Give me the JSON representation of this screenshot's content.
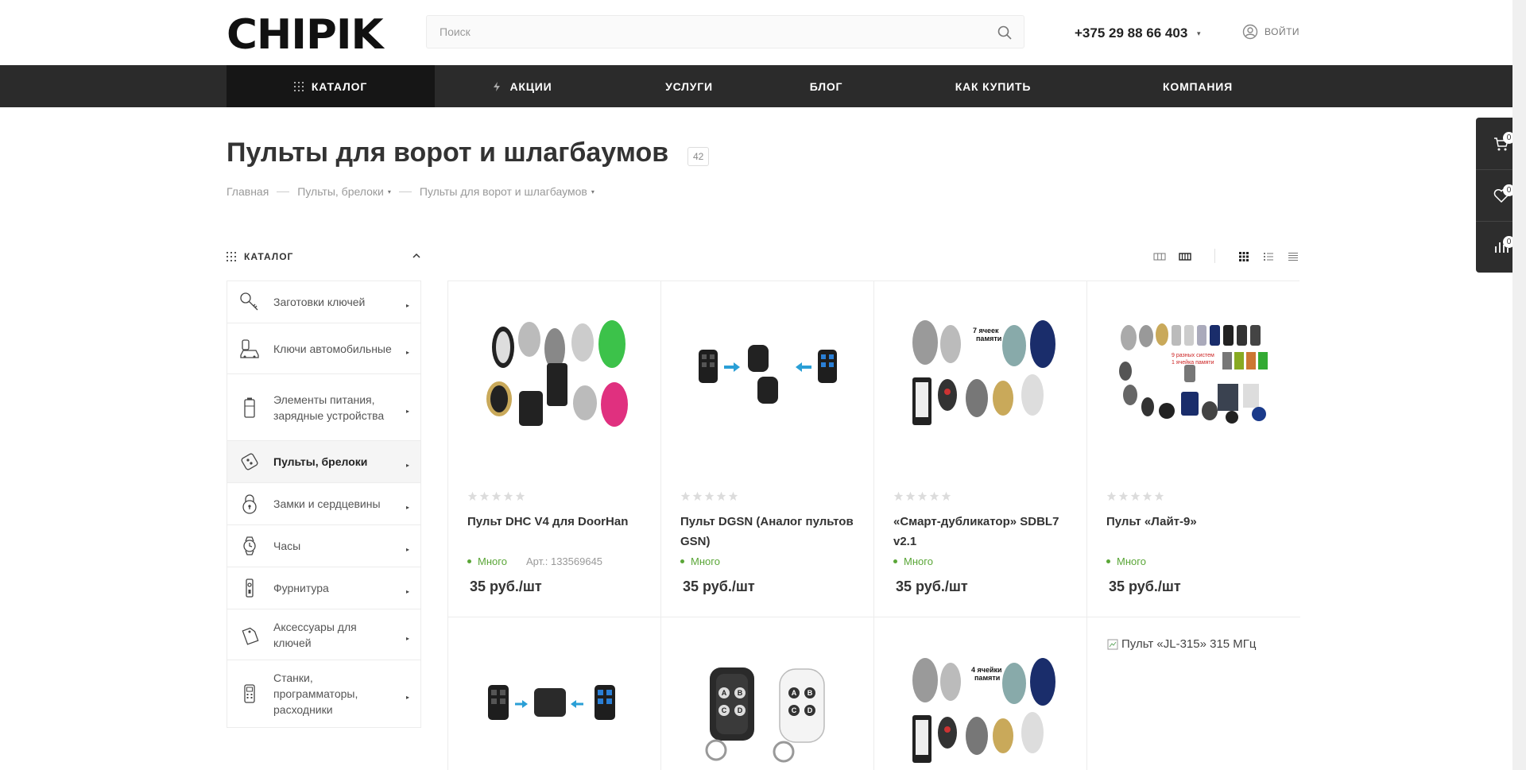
{
  "header": {
    "logo": "CHIPIK",
    "search_placeholder": "Поиск",
    "phone": "+375 29 88 66 403",
    "login_label": "ВОЙТИ"
  },
  "nav": {
    "items": [
      {
        "label": "КАТАЛОГ",
        "icon": "grid-icon"
      },
      {
        "label": "АКЦИИ",
        "icon": "lightning-icon"
      },
      {
        "label": "УСЛУГИ"
      },
      {
        "label": "БЛОГ"
      },
      {
        "label": "КАК КУПИТЬ"
      },
      {
        "label": "КОМПАНИЯ"
      }
    ]
  },
  "page": {
    "title": "Пульты для ворот и шлагбаумов",
    "count": "42",
    "breadcrumbs": [
      "Главная",
      "Пульты, брелоки",
      "Пульты для ворот и шлагбаумов"
    ]
  },
  "sidebar": {
    "heading": "КАТАЛОГ",
    "items": [
      {
        "label": "Заготовки ключей",
        "icon": "key-blank-icon"
      },
      {
        "label": "Ключи автомобильные",
        "icon": "car-key-icon"
      },
      {
        "label": "Элементы питания, зарядные устройства",
        "icon": "battery-icon"
      },
      {
        "label": "Пульты, брелоки",
        "icon": "remote-icon"
      },
      {
        "label": "Замки и сердцевины",
        "icon": "padlock-icon"
      },
      {
        "label": "Часы",
        "icon": "watch-icon"
      },
      {
        "label": "Фурнитура",
        "icon": "door-handle-icon"
      },
      {
        "label": "Аксессуары для ключей",
        "icon": "key-tag-icon"
      },
      {
        "label": "Станки, программаторы, расходники",
        "icon": "programmer-icon"
      }
    ]
  },
  "products": [
    {
      "title": "Пульт DHC V4 для DoorHan",
      "stock": "Много",
      "sku": "Арт.: 133569645",
      "price": "35 руб./шт"
    },
    {
      "title": "Пульт DGSN (Аналог пультов GSN)",
      "stock": "Много",
      "sku": "",
      "price": "35 руб./шт"
    },
    {
      "title": "«Смарт-дубликатор» SDBL7 v2.1",
      "stock": "Много",
      "sku": "",
      "price": "35 руб./шт"
    },
    {
      "title": "Пульт «Лайт-9»",
      "stock": "Много",
      "sku": "",
      "price": "35 руб./шт"
    }
  ],
  "row2": {
    "broken_image_alt": "Пульт «JL-315» 315 МГц"
  },
  "image_text": {
    "p3_label_line1": "7 ячеек",
    "p3_label_line2": "памяти",
    "p4_label_line1": "9 разных систем",
    "p4_label_line2": "1 ячейка памяти",
    "r2c3_label_line1": "4 ячейки",
    "r2c3_label_line2": "памяти",
    "abcd": [
      "A",
      "B",
      "C",
      "D"
    ]
  },
  "float_panel": {
    "cart_count": "0",
    "favorites_count": "0",
    "compare_count": "0"
  },
  "colors": {
    "nav_bg": "#2b2b2b",
    "nav_active": "#161616",
    "stock_green": "#5aa637"
  }
}
